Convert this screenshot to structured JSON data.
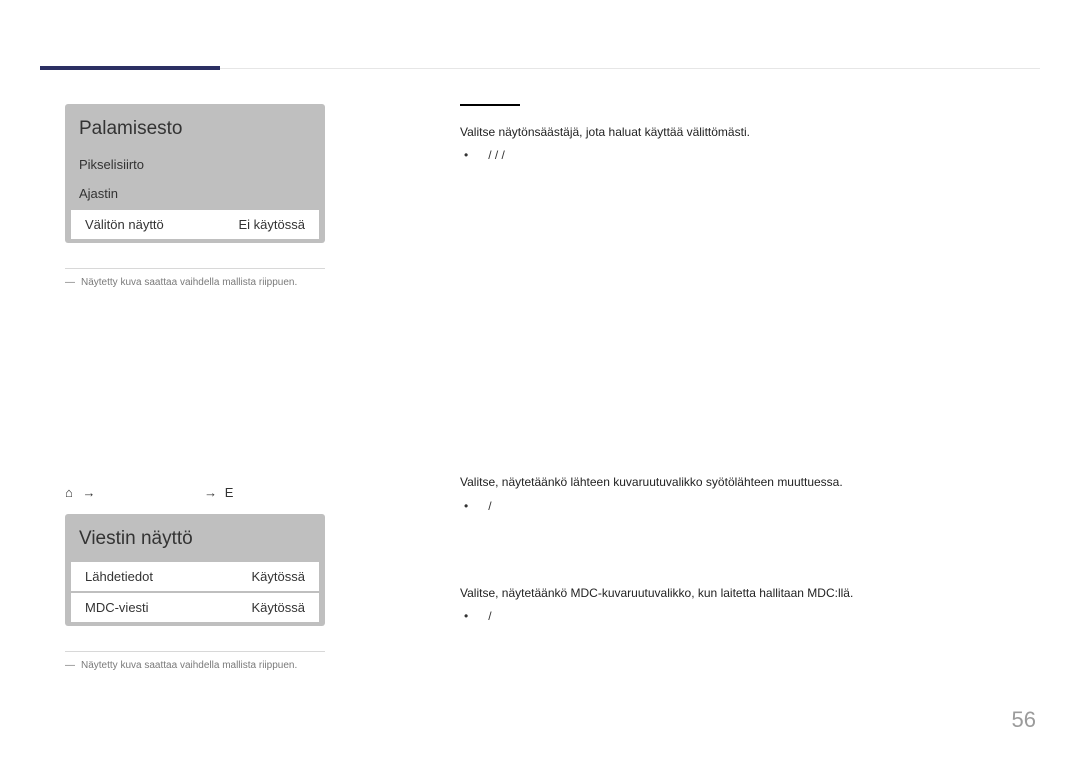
{
  "page_number": "56",
  "palamisesto": {
    "title": "Palamisesto",
    "rows": [
      {
        "label": "Pikselisiirto",
        "value": ""
      },
      {
        "label": "Ajastin",
        "value": ""
      },
      {
        "label": "Välitön näyttö",
        "value": "Ei käytössä"
      }
    ]
  },
  "footnote1": "Näytetty kuva saattaa vaihdella mallista riippuen.",
  "nav": {
    "arrow1": "→",
    "arrow2": "→",
    "suffix": "E"
  },
  "viestin": {
    "title": "Viestin näyttö",
    "rows": [
      {
        "label": "Lähdetiedot",
        "value": "Käytössä"
      },
      {
        "label": "MDC-viesti",
        "value": "Käytössä"
      }
    ]
  },
  "footnote2": "Näytetty kuva saattaa vaihdella mallista riippuen.",
  "right": {
    "block1": {
      "text": "Valitse näytönsäästäjä, jota haluat käyttää välittömästi.",
      "bullet": "/  /  /"
    },
    "block2": {
      "text": "Valitse, näytetäänkö lähteen kuvaruutuvalikko syötölähteen muuttuessa.",
      "bullet": "/"
    },
    "block3": {
      "text": "Valitse, näytetäänkö MDC-kuvaruutuvalikko, kun laitetta hallitaan MDC:llä.",
      "bullet": "/"
    }
  }
}
